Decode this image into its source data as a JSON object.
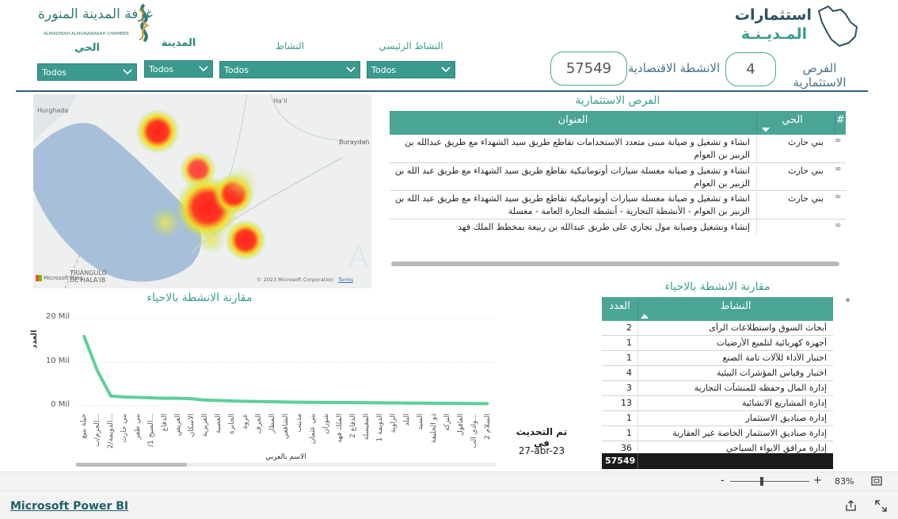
{
  "header": {
    "chamber_logo_text_ar": "غرفة المدينة المنورة",
    "chamber_logo_text_en": "ALMADINAH ALMUNAWARAH CHAMBER",
    "brand_title_line1": "استثمارات",
    "brand_title_line2": "المـديـنـة"
  },
  "filters": {
    "district": {
      "label": "الحي",
      "value": "Todos"
    },
    "city": {
      "label": "المدينة",
      "value": "Todos"
    },
    "activity": {
      "label": "النشاط",
      "value": "Todos"
    },
    "main_activity": {
      "label": "النشاط الرئيسي",
      "value": "Todos"
    }
  },
  "kpis": {
    "activities": {
      "label": "الانشطة الاقتصادية",
      "value": "57549"
    },
    "opportunities": {
      "label": "الفرص الاستثمارية",
      "value": "4"
    }
  },
  "map": {
    "places": [
      "Ha'il",
      "Hurghada",
      "Buraydah",
      "TRIÁNGULO DE HALA'IB"
    ],
    "brand": "Microsoft Bing",
    "copyright": "© 2023 Microsoft Corporation",
    "terms": "Terms"
  },
  "opportunities_table": {
    "title": "الفرص الاستثمارية",
    "headers": {
      "num": "#",
      "district": "الحي",
      "address": "العنوان"
    },
    "rows": [
      {
        "district": "بني حارث",
        "address": "انشاء و تشغيل و صيانة مبنى متعدد الاستخدامات تقاطع طريق سيد الشهداء مع طريق عبدالله بن الزبير بن العوام"
      },
      {
        "district": "بني حارث",
        "address": "انشاء و تشغيل و صيانة مغسلة سيارات أوتوماتيكية تقاطع طريق سيد الشهداء مع طريق عبد الله بن الزبير بن العوام"
      },
      {
        "district": "بني حارث",
        "address": "انشاء و تشغيل و صيانة مغسلة سيارات أوتوماتيكية تقاطع طريق سيد الشهداء مع طريق عبد الله بن الزبير بن العوام - الأنشطة التجارية - أنشطة التجارة العامة - مغسلة"
      },
      {
        "district": "",
        "address": "إنشاء وتشغيل وصيانة مول تجاري على طريق عبدالله بن ربيعة بمخطط الملك فهد"
      }
    ]
  },
  "activities_table": {
    "title": "مقارنة الانشطة بالاحياء",
    "headers": {
      "activity": "النشاط",
      "count": "العدد"
    },
    "rows": [
      {
        "activity": "أبحاث السوق واستطلاعات الرأى",
        "count": "2"
      },
      {
        "activity": "أجهزة كهربائية لتلميع الأرضيات",
        "count": "1"
      },
      {
        "activity": "اختبار الأداء للآلات تامة الصنع",
        "count": "1"
      },
      {
        "activity": "اختبار وقياس المؤشرات البيئية",
        "count": "4"
      },
      {
        "activity": "إدارة المال وحفظه للمنشآت التجارية",
        "count": "3"
      },
      {
        "activity": "إدارة المشاريع الانشائية",
        "count": "13"
      },
      {
        "activity": "إدارة صناديق الاستثمار",
        "count": "1"
      },
      {
        "activity": "إدارة صناديق الاستثمار الخاصة غير العقارية",
        "count": "1"
      },
      {
        "activity": "إدارة مرافق الايواء السياحي",
        "count": "36"
      }
    ],
    "total": "57549"
  },
  "line_chart": {
    "title": "مقارنة الانشطة بالاحياء",
    "y_axis_title": "العدد",
    "x_axis_title": "الاسم بالعربي",
    "y_ticks": [
      "20 Mil",
      "10 Mil",
      "0 Mil"
    ]
  },
  "chart_data": {
    "type": "line",
    "title": "مقارنة الانشطة بالاحياء",
    "xlabel": "الاسم بالعربي",
    "ylabel": "العدد",
    "ylim": [
      0,
      22000
    ],
    "grid": true,
    "categories": [
      "حيلة بنيع",
      "...الحرم/ب",
      "...الدويمة/2",
      "بني حارث",
      "بني ظفر",
      "...السيح 1/",
      "الدفاع",
      "العريض",
      "الاسكان",
      "العزيزية",
      "العصبة",
      "الجابرة",
      "عروة",
      "الجرف",
      "المطار",
      "الشافعي",
      "مذينب",
      "بني عثمان",
      "شوران",
      "الملك فهد",
      "الدفاع 2",
      "المغيسلة",
      "الدويمة 1",
      "الراوية",
      "البلد",
      "السيد",
      "ذو الحليفة",
      "البركة",
      "العاقول",
      "...وادي الب",
      "السلام 2"
    ],
    "values": [
      16000,
      8000,
      2200,
      2000,
      1900,
      1800,
      1700,
      1700,
      1600,
      1300,
      1200,
      1100,
      1000,
      950,
      900,
      850,
      800,
      780,
      750,
      720,
      700,
      680,
      650,
      630,
      600,
      580,
      560,
      540,
      520,
      500,
      480
    ]
  },
  "updated": {
    "label": "تم التحديث في",
    "value": "27-abr-23"
  },
  "zoom": {
    "minus": "-",
    "plus": "+",
    "percent": "83%"
  },
  "footer": {
    "brand": "Microsoft Power BI"
  },
  "colors": {
    "teal": "#4aa597",
    "line": "#5fcf9a",
    "header_blue": "#2f5f7a"
  }
}
